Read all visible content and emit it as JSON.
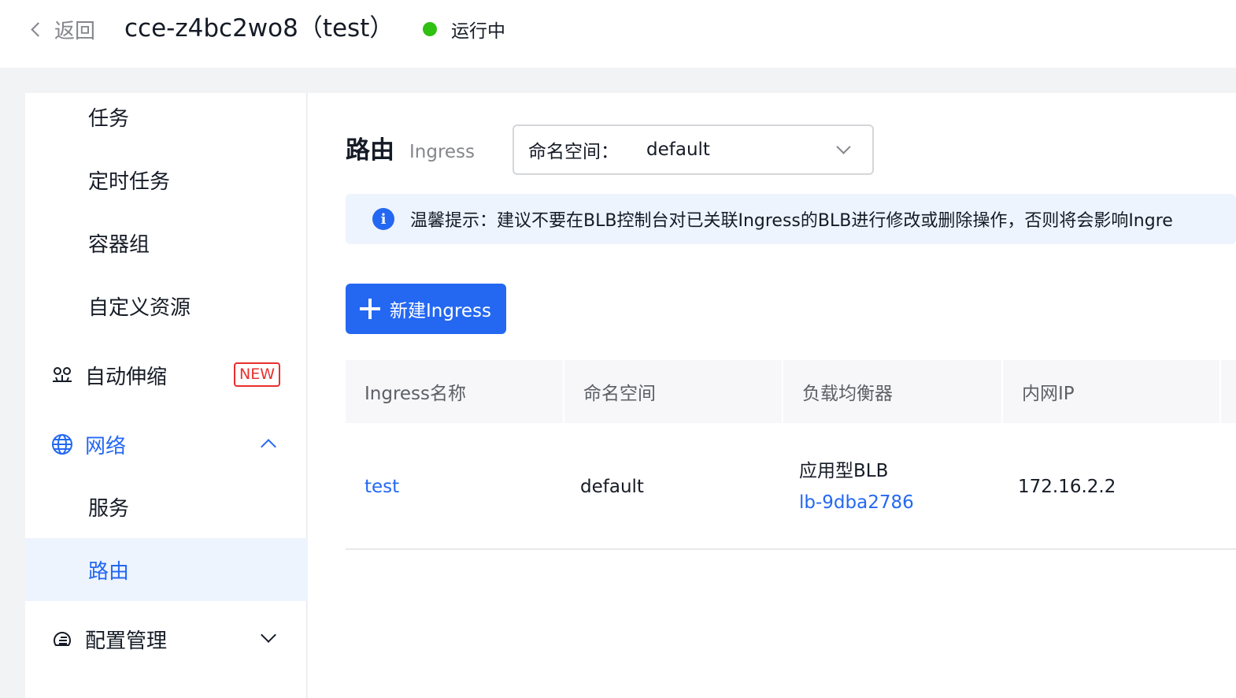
{
  "header": {
    "back_label": "返回",
    "cluster_title": "cce-z4bc2wo8（test）",
    "status_text": "运行中",
    "status_color": "#30bf13"
  },
  "sidebar": {
    "items": [
      {
        "label": "任务",
        "type": "sub"
      },
      {
        "label": "定时任务",
        "type": "sub"
      },
      {
        "label": "容器组",
        "type": "sub"
      },
      {
        "label": "自定义资源",
        "type": "sub"
      },
      {
        "label": "自动伸缩",
        "type": "group",
        "icon": "autoscale-icon",
        "badge": "NEW"
      },
      {
        "label": "网络",
        "type": "group",
        "icon": "globe-icon",
        "expanded": true
      },
      {
        "label": "服务",
        "type": "sub"
      },
      {
        "label": "路由",
        "type": "sub",
        "active": true
      },
      {
        "label": "配置管理",
        "type": "group",
        "icon": "config-icon",
        "expanded": false
      }
    ]
  },
  "main": {
    "title": "路由",
    "subtitle": "Ingress",
    "namespace_select": {
      "label": "命名空间：",
      "value": "default"
    },
    "tip_label": "温馨提示：",
    "tip_text": "建议不要在BLB控制台对已关联Ingress的BLB进行修改或删除操作，否则将会影响Ingre",
    "create_button": "新建Ingress",
    "table": {
      "columns": [
        "Ingress名称",
        "命名空间",
        "负载均衡器",
        "内网IP"
      ],
      "rows": [
        {
          "name": "test",
          "namespace": "default",
          "lb_type": "应用型BLB",
          "lb_id": "lb-9dba2786",
          "ip": "172.16.2.2"
        }
      ]
    }
  },
  "colors": {
    "accent": "#2468f2",
    "badge_red": "#e8302d",
    "active_bg": "#eef4fe"
  }
}
